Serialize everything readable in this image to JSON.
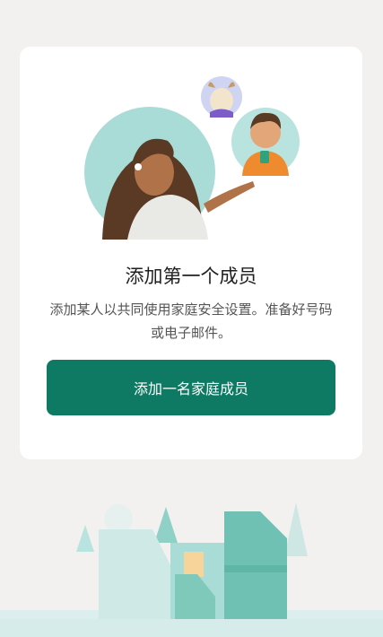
{
  "empty_state": {
    "title": "添加第一个成员",
    "description": "添加某人以共同使用家庭安全设置。准备好号码或电子邮件。",
    "add_button_label": "添加一名家庭成员"
  },
  "colors": {
    "accent": "#0e7a63",
    "illustration_teal": "#b9e3df",
    "background": "#f2f1ef"
  },
  "icons": [
    "family-illustration",
    "neighborhood-illustration"
  ]
}
